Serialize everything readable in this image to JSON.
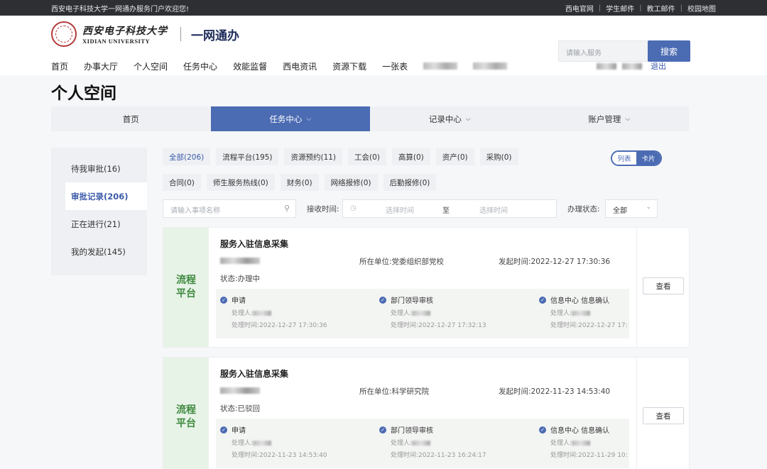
{
  "topbar": {
    "welcome": "西安电子科技大学一网通办服务门户欢迎您!",
    "links": [
      "西电官网",
      "学生邮件",
      "教工邮件",
      "校园地图"
    ],
    "separator": "|"
  },
  "header": {
    "logo_cn": "西安电子科技大学",
    "logo_en": "XIDIAN UNIVERSITY",
    "app_name": "一网通办",
    "search_placeholder": "请输入服务",
    "search_button": "搜索"
  },
  "nav": {
    "items": [
      "首页",
      "办事大厅",
      "个人空间",
      "任务中心",
      "效能监督",
      "西电资讯",
      "资源下载",
      "一张表"
    ]
  },
  "user": {
    "logout": "退出"
  },
  "page": {
    "title": "个人空间"
  },
  "tabs": [
    {
      "label": "首页",
      "chevron": ""
    },
    {
      "label": "任务中心",
      "chevron": "⌵"
    },
    {
      "label": "记录中心",
      "chevron": "⌵"
    },
    {
      "label": "账户管理",
      "chevron": "⌵"
    }
  ],
  "sidebar": {
    "items": [
      "待我审批(16)",
      "审批记录(206)",
      "正在进行(21)",
      "我的发起(145)"
    ],
    "active_index": 1
  },
  "chips": [
    "全部(206)",
    "流程平台(195)",
    "资源预约(11)",
    "工会(0)",
    "高算(0)",
    "资产(0)",
    "采购(0)",
    "合同(0)",
    "师生服务热线(0)",
    "财务(0)",
    "网络报修(0)",
    "后勤报修(0)"
  ],
  "view_toggle": {
    "list": "列表",
    "card": "卡片",
    "selected": "卡片"
  },
  "filters": {
    "name_placeholder": "请输入事项名称",
    "recv_label": "接收时间:",
    "date_start": "选择时间",
    "date_to": "至",
    "date_end": "选择时间",
    "status_label": "办理状态:",
    "status_value": "全部"
  },
  "cards": [
    {
      "tag_line1": "流程",
      "tag_line2": "平台",
      "title": "服务入驻信息采集",
      "unit": "所在单位:党委组织部党校",
      "time": "发起时间:2022-12-27 17:30:36",
      "status": "状态:办理中",
      "steps": [
        {
          "name": "申请",
          "handler_label": "处理人:",
          "time": "处理时间:2022-12-27 17:30:36"
        },
        {
          "name": "部门领导审核",
          "handler_label": "处理人:",
          "time": "处理时间:2022-12-27 17:32:13"
        },
        {
          "name": "信息中心 信息确认",
          "handler_label": "处理人:",
          "time": "处理时间:2022-12-27 17:"
        }
      ],
      "view": "查看"
    },
    {
      "tag_line1": "流程",
      "tag_line2": "平台",
      "title": "服务入驻信息采集",
      "unit": "所在单位:科学研究院",
      "time": "发起时间:2022-11-23 14:53:40",
      "status": "状态:已驳回",
      "steps": [
        {
          "name": "申请",
          "handler_label": "处理人:",
          "time": "处理时间:2022-11-23 14:53:40"
        },
        {
          "name": "部门领导审核",
          "handler_label": "处理人:",
          "time": "处理时间:2022-11-23 16:24:17"
        },
        {
          "name": "信息中心 信息确认",
          "handler_label": "处理人:",
          "time": "处理时间:2022-11-29 10:"
        }
      ],
      "view": "查看"
    }
  ],
  "colors": {
    "accent": "#4b6bb3",
    "tag_green": "#3f8a3f",
    "topbar": "#2d2f33"
  }
}
